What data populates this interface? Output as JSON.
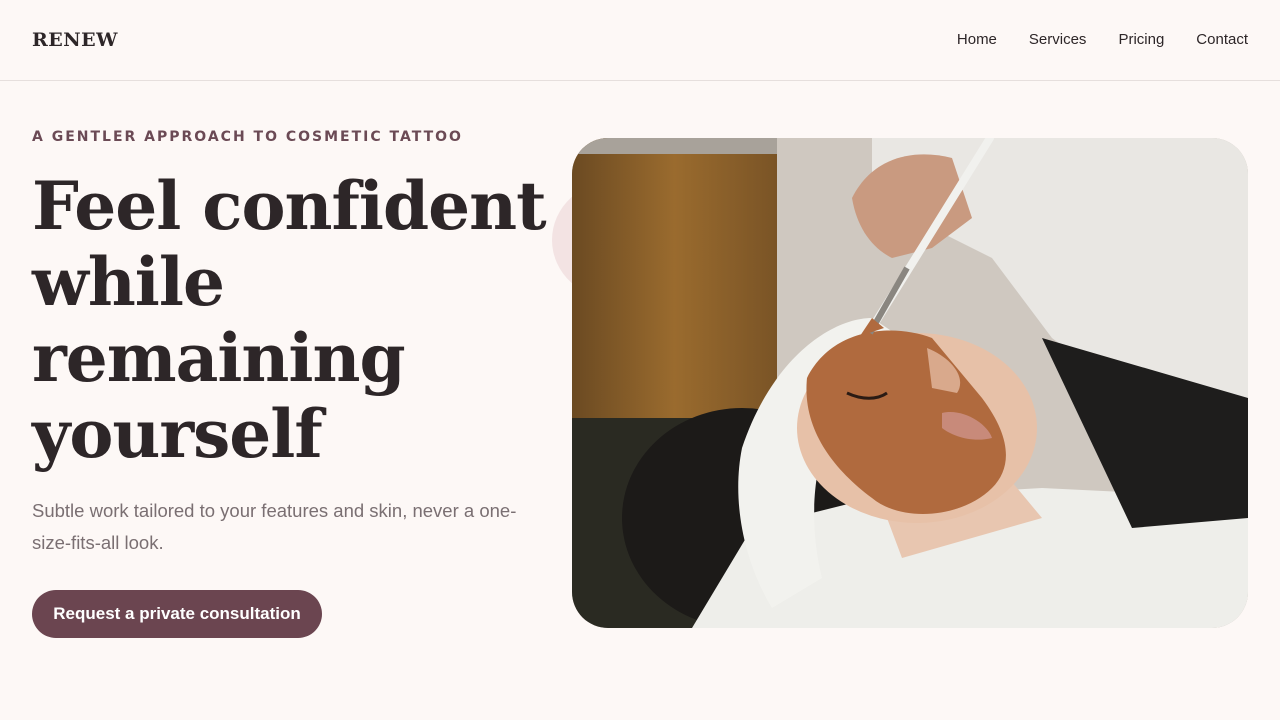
{
  "header": {
    "logo": "RENEW",
    "nav": [
      "Home",
      "Services",
      "Pricing",
      "Contact"
    ]
  },
  "hero": {
    "eyebrow": "A GENTLER APPROACH TO COSMETIC TATTOO",
    "headline": [
      "Feel confident",
      "while",
      "remaining",
      "yourself"
    ],
    "subtitle": "Subtle work tailored to your features and skin, never a one-size-fits-all look.",
    "cta": "Request a private consultation"
  },
  "colors": {
    "background": "#fdf8f6",
    "text": "#2d2628",
    "accent": "#6b4550",
    "eyebrow": "#6b4a55",
    "muted": "#7a6f72"
  },
  "image": {
    "subject": "client-receiving-facial-mask-treatment"
  }
}
